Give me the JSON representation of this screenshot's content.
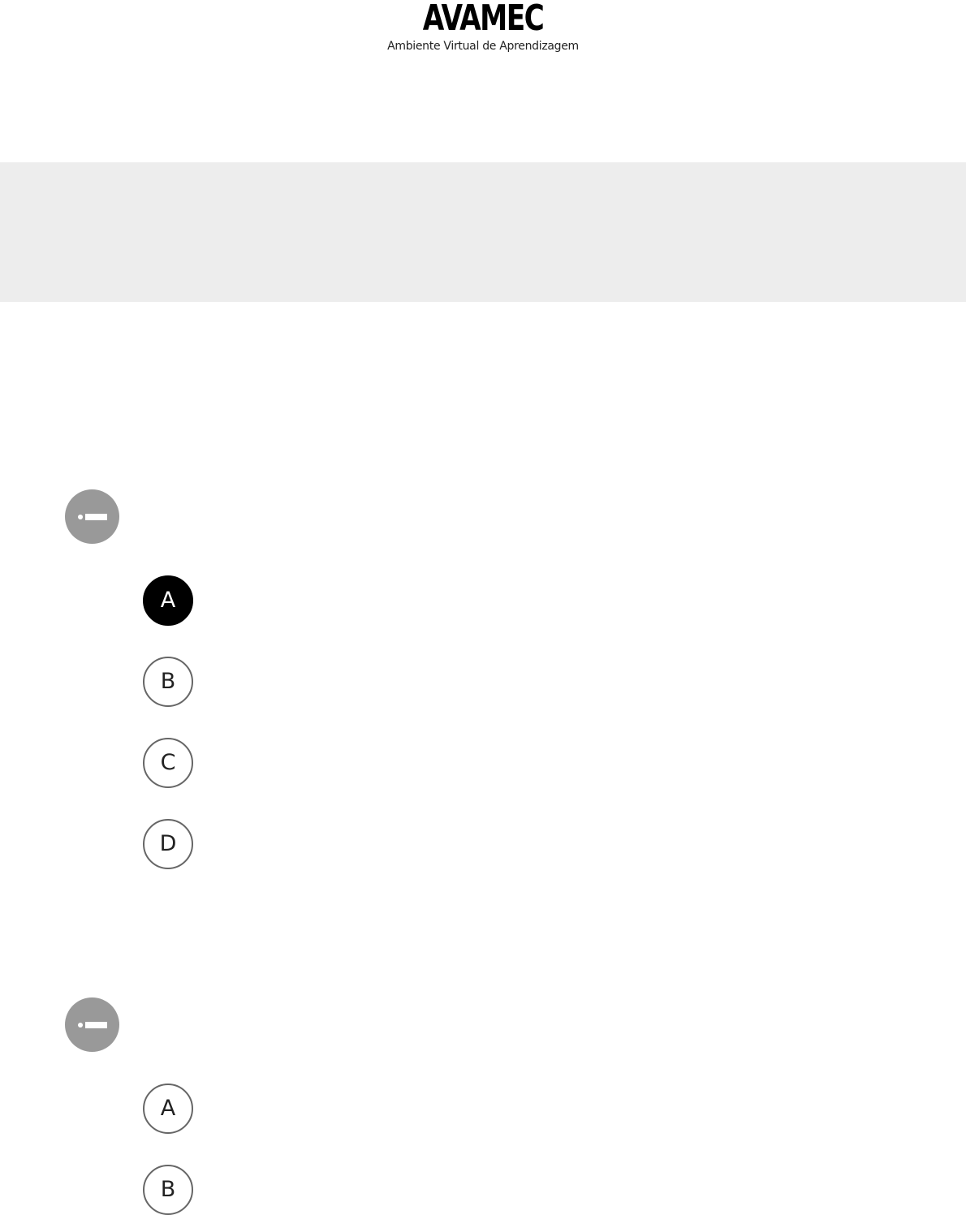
{
  "header": {
    "logo_text": "AVAMEC",
    "logo_subtitle": "Ambiente Virtual de Aprendizagem"
  },
  "questions": [
    {
      "status_icon": "minus-circle-icon",
      "options": [
        {
          "letter": "A",
          "selected": true
        },
        {
          "letter": "B",
          "selected": false
        },
        {
          "letter": "C",
          "selected": false
        },
        {
          "letter": "D",
          "selected": false
        }
      ]
    },
    {
      "status_icon": "minus-circle-icon",
      "options": [
        {
          "letter": "A",
          "selected": false
        },
        {
          "letter": "B",
          "selected": false
        }
      ]
    }
  ],
  "colors": {
    "banner": "#ededed",
    "status_icon_bg": "#999999",
    "selected_option": "#000000",
    "option_border": "#666666"
  }
}
